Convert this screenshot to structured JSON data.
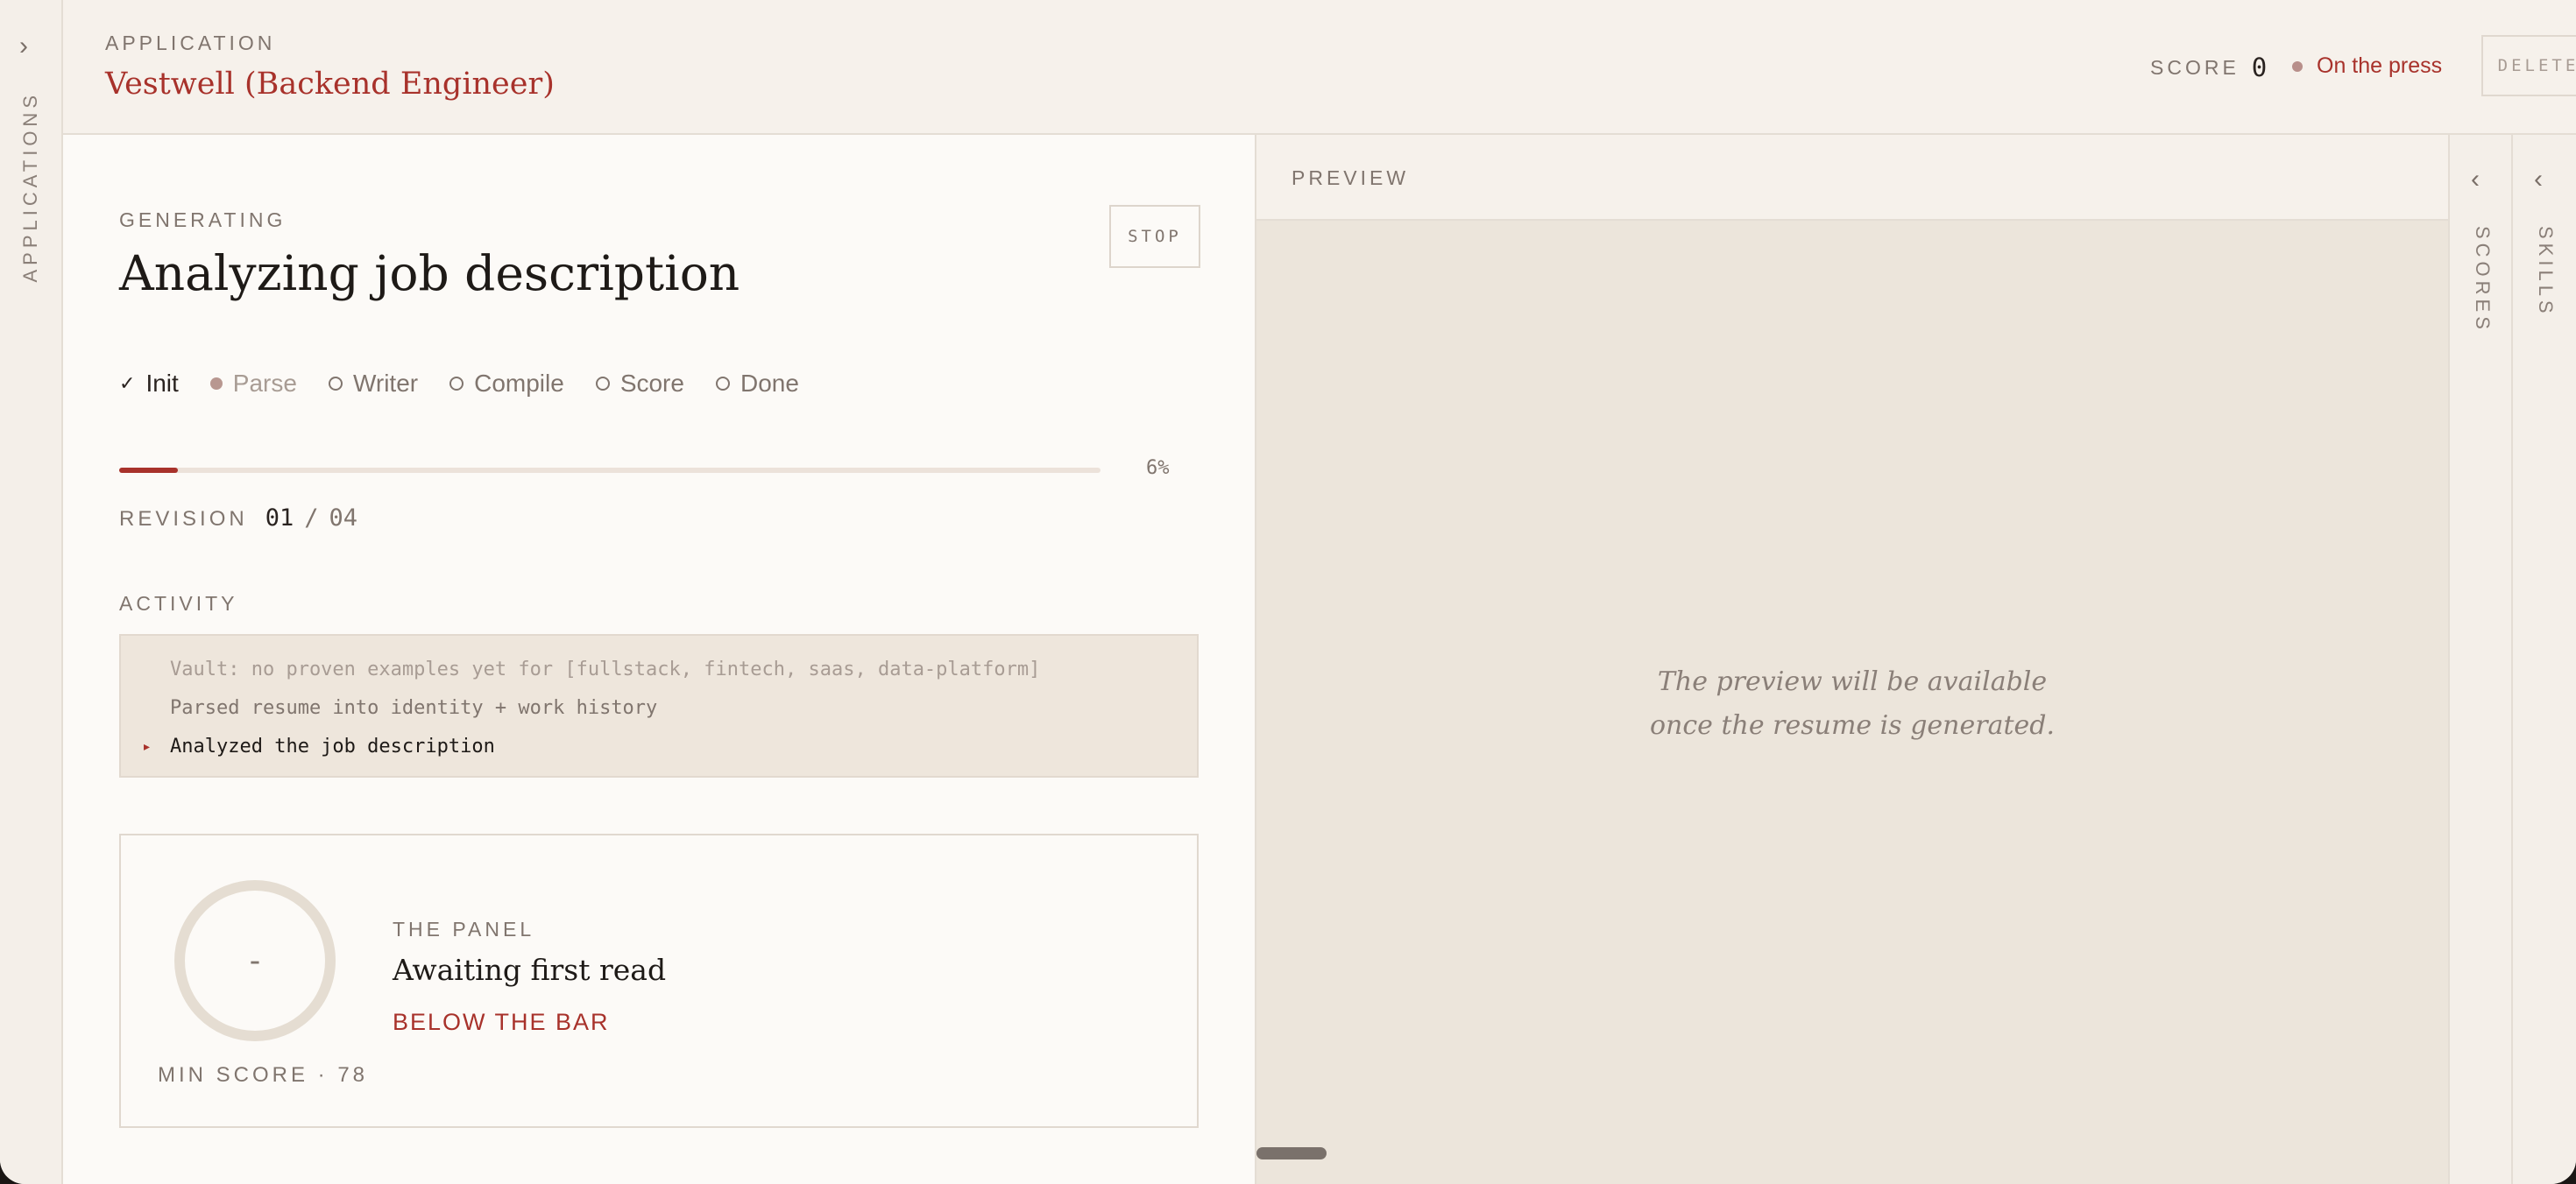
{
  "nav": {
    "applications_label": "APPLICATIONS",
    "expand_icon": "chevron-right-icon"
  },
  "header": {
    "eyebrow": "APPLICATION",
    "title": "Vestwell (Backend Engineer)",
    "score_label": "SCORE",
    "score_value": "0",
    "status": "On the press",
    "delete_label": "DELETE"
  },
  "generating": {
    "eyebrow": "GENERATING",
    "title": "Analyzing job description",
    "stop_label": "STOP",
    "steps": [
      {
        "label": "Init",
        "state": "done",
        "mark": "✓"
      },
      {
        "label": "Parse",
        "state": "active"
      },
      {
        "label": "Writer",
        "state": "pending"
      },
      {
        "label": "Compile",
        "state": "pending"
      },
      {
        "label": "Score",
        "state": "pending"
      },
      {
        "label": "Done",
        "state": "pending"
      }
    ],
    "progress_value": 0.06,
    "progress_label": "6%",
    "revision_label": "REVISION",
    "revision_current": "01",
    "revision_separator": "/",
    "revision_total": "04"
  },
  "activity": {
    "eyebrow": "ACTIVITY",
    "lines": [
      "Vault: no proven examples yet for [fullstack, fintech, saas, data-platform]",
      "Parsed resume into identity + work history",
      "Analyzed the job description"
    ],
    "current_marker": "▸"
  },
  "the_panel": {
    "eyebrow": "THE PANEL",
    "title": "Awaiting first read",
    "verdict": "BELOW THE BAR",
    "gauge_value": "-",
    "min_score_label": "MIN SCORE · 78"
  },
  "preview": {
    "eyebrow": "PREVIEW",
    "message_line1": "The preview will be available",
    "message_line2": "once the resume is generated."
  },
  "right_rails": {
    "scores_label": "SCORES",
    "skills_label": "SKILLS",
    "collapse_icon": "chevron-left-icon"
  },
  "colors": {
    "accent": "#a8322b",
    "background": "#f7f3ee",
    "preview_bg": "#ece5db",
    "muted_text": "#80756e"
  }
}
